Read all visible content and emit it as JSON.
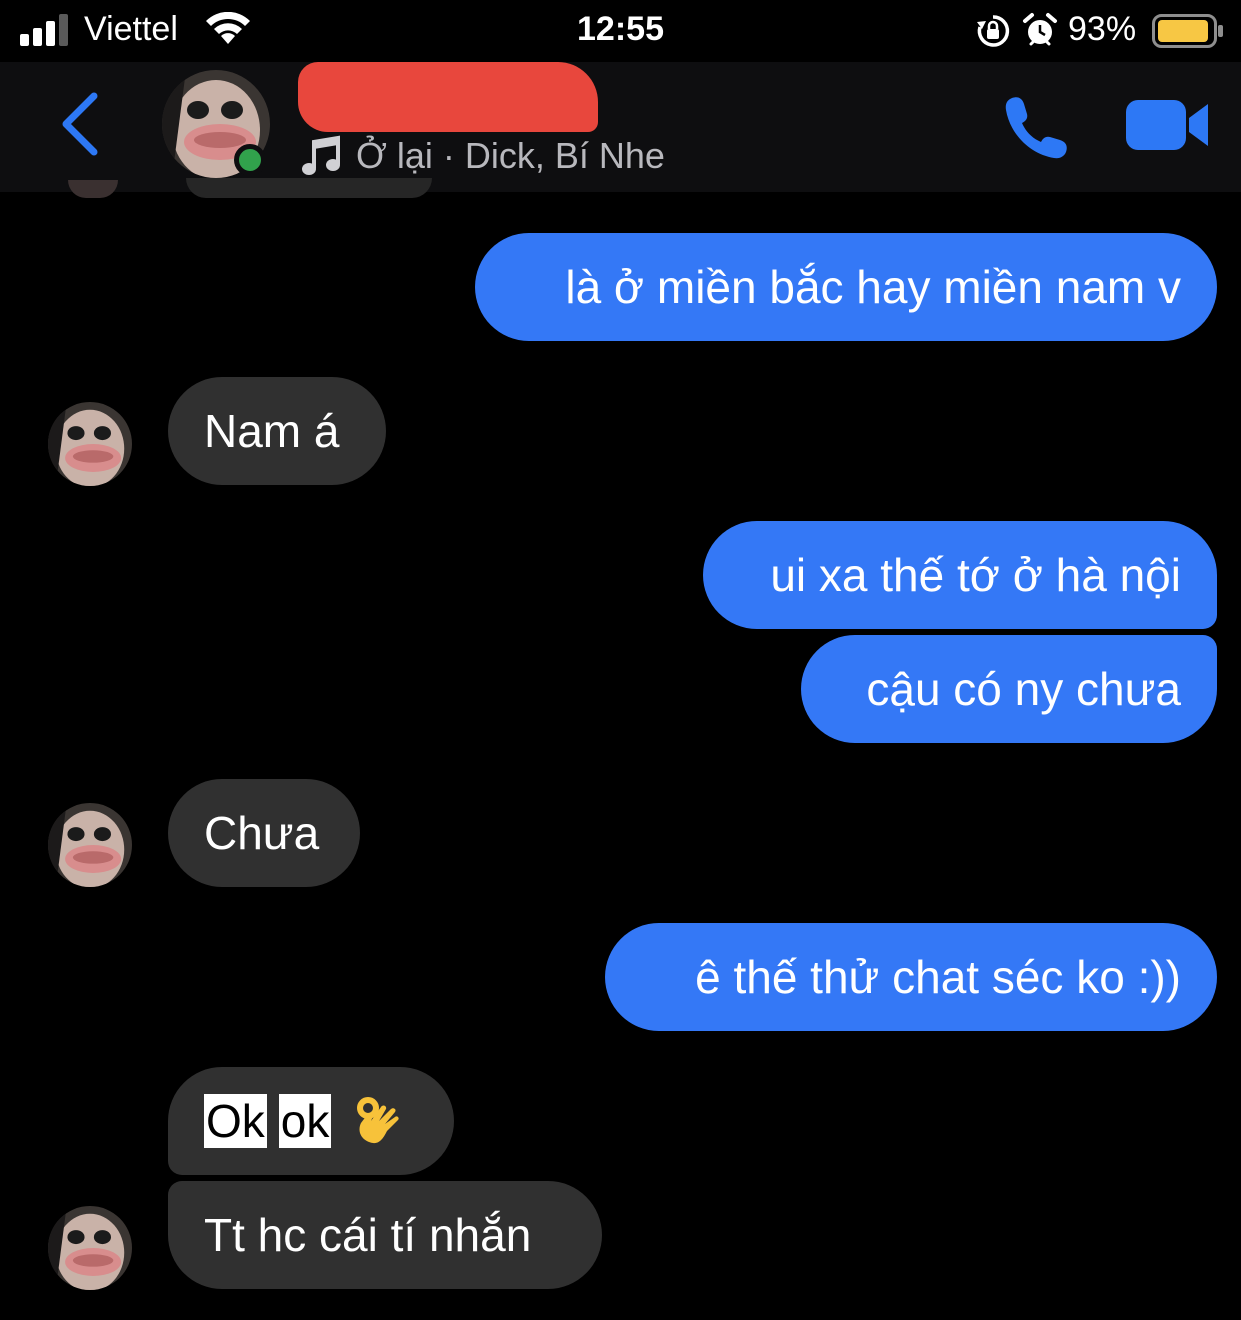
{
  "status_bar": {
    "carrier": "Viettel",
    "time": "12:55",
    "battery_percent": "93%",
    "icons": [
      "signal-icon",
      "wifi-icon",
      "rotation-lock-icon",
      "alarm-icon",
      "battery-icon"
    ],
    "battery_level": 0.93,
    "battery_color": "#f7c744"
  },
  "header": {
    "contact_name": "",
    "subtitle": "Ở lại · Dick, Bí Nhe",
    "icons": [
      "back-chevron-icon",
      "music-note-icon",
      "phone-icon",
      "video-camera-icon"
    ],
    "accent_color": "#2d78f5",
    "online_color": "#31a24c",
    "redaction_color": "#e8473d"
  },
  "messages": [
    {
      "from": "me",
      "text": "là ở miền bắc hay miền nam v"
    },
    {
      "from": "them",
      "text": "Nam á"
    },
    {
      "from": "me",
      "text": "ui xa thế tớ ở hà nội"
    },
    {
      "from": "me",
      "text": "cậu có ny chưa"
    },
    {
      "from": "them",
      "text": "Chưa"
    },
    {
      "from": "me",
      "text": "ê thế thử chat séc ko :))"
    },
    {
      "from": "them",
      "parts": [
        "Ok",
        "ok"
      ],
      "emoji": "ok-hand-icon"
    },
    {
      "from": "them",
      "text": "Tt hc cái tí nhắn"
    }
  ],
  "colors": {
    "outgoing_bubble": "#3478f6",
    "incoming_bubble": "#303030",
    "background": "#000000"
  }
}
